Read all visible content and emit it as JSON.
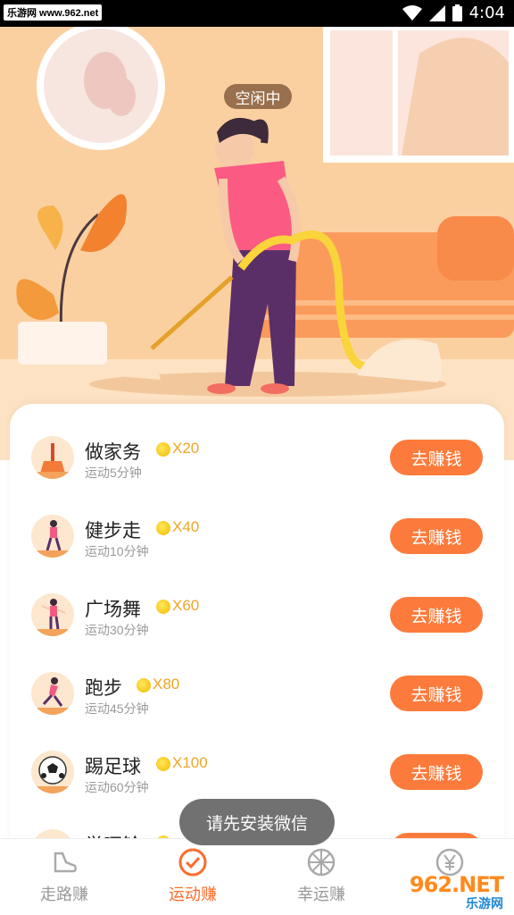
{
  "status_bar": {
    "watermark_text": "乐游网 www.962.net",
    "time": "4:04",
    "icons": [
      "wifi-icon",
      "cell-signal-icon",
      "battery-icon"
    ]
  },
  "hero": {
    "status_badge": "空闲中",
    "illustration": "woman-vacuuming-illustration"
  },
  "tasks": [
    {
      "name": "做家务",
      "reward": "X20",
      "sub": "运动5分钟",
      "button": "去赚钱",
      "icon": "broom-icon"
    },
    {
      "name": "健步走",
      "reward": "X40",
      "sub": "运动10分钟",
      "button": "去赚钱",
      "icon": "walking-icon"
    },
    {
      "name": "广场舞",
      "reward": "X60",
      "sub": "运动30分钟",
      "button": "去赚钱",
      "icon": "dancing-icon"
    },
    {
      "name": "跑步",
      "reward": "X80",
      "sub": "运动45分钟",
      "button": "去赚钱",
      "icon": "running-icon"
    },
    {
      "name": "踢足球",
      "reward": "X100",
      "sub": "运动60分钟",
      "button": "去赚钱",
      "icon": "soccer-ball-icon"
    },
    {
      "name": "举哑铃",
      "reward": "",
      "sub": "",
      "button": "",
      "icon": "dumbbell-icon"
    }
  ],
  "toast": "请先安装微信",
  "nav": [
    {
      "label": "走路赚",
      "icon": "sneaker-icon",
      "active": false
    },
    {
      "label": "运动赚",
      "icon": "check-circle-icon",
      "active": true
    },
    {
      "label": "幸运赚",
      "icon": "wheel-icon",
      "active": false
    },
    {
      "label": "",
      "icon": "yen-coin-icon",
      "active": false
    }
  ],
  "watermark": {
    "big": "962.NET",
    "small": "乐游网"
  },
  "colors": {
    "accent": "#fc7b3c",
    "nav_active": "#fb6d2c",
    "coin": "#f2b800",
    "hero_bg": "#fbd3a4"
  }
}
